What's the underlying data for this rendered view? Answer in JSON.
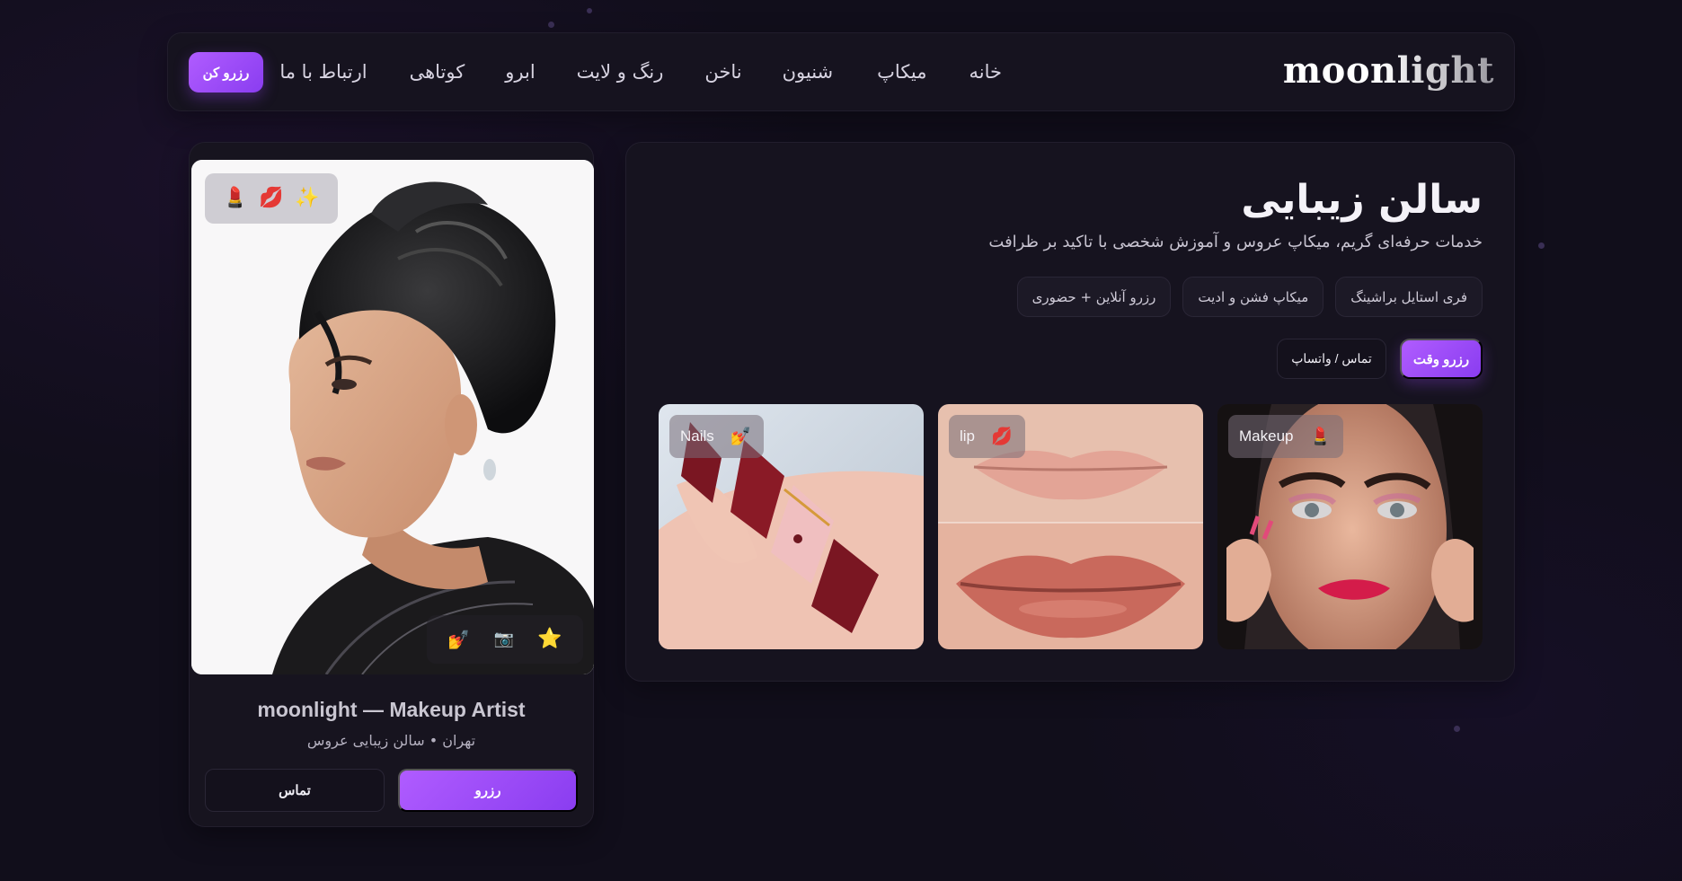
{
  "nav": {
    "brand": "moonlight",
    "links": [
      "خانه",
      "میکاپ",
      "شنیون",
      "ناخن",
      "رنگ و لایت",
      "ابرو",
      "کوتاهی",
      "ارتباط با ما"
    ],
    "cta": "رزرو کن"
  },
  "profile": {
    "top_icons": [
      "💄",
      "💋",
      "✨"
    ],
    "bottom_icons": [
      "💅",
      "📷",
      "⭐"
    ],
    "name": "moonlight — Makeup Artist",
    "subtitle": "تهران • سالن زیبایی عروس",
    "book_label": "رزرو",
    "contact_label": "تماس"
  },
  "hero": {
    "title": "سالن زیبایی",
    "description": "خدمات حرفه‌ای گریم، میکاپ عروس و آموزش شخصی با تاکید بر ظرافت",
    "chips": [
      "فری استایل براشینگ",
      "میکاپ فشن و ادیت",
      "رزرو آنلاین + حضوری"
    ],
    "primary_button": "رزرو وقت",
    "secondary_button": "تماس / واتساپ",
    "gallery": [
      {
        "label": "Makeup",
        "icon": "💄",
        "icon_name": "lipstick-icon"
      },
      {
        "label": "lip",
        "icon": "💋",
        "icon_name": "kiss-icon"
      },
      {
        "label": "Nails",
        "icon": "💅",
        "icon_name": "nail-polish-icon"
      }
    ]
  },
  "colors": {
    "background": "#110e1b",
    "panel": "#16131f",
    "accent": "#a04cf8",
    "accent_gradient_start": "#b05cff",
    "accent_gradient_end": "#8a3df0"
  }
}
